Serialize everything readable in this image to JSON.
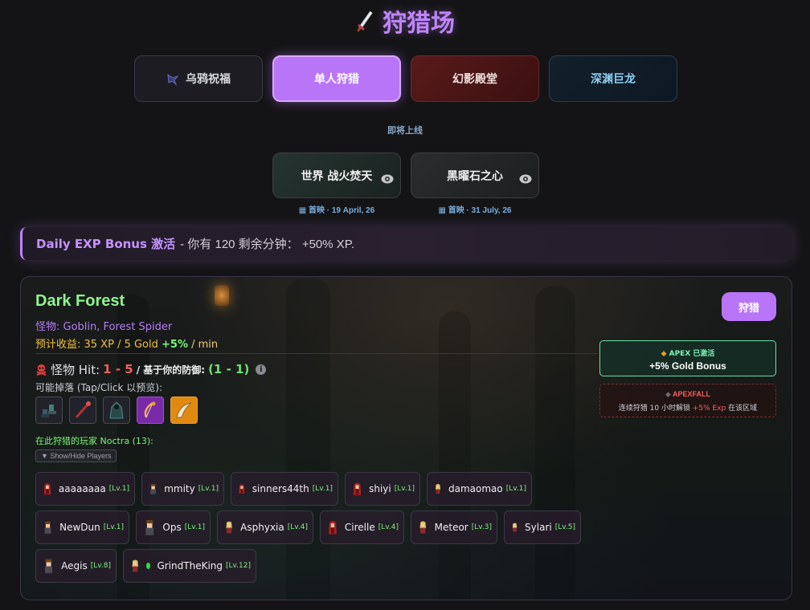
{
  "header": {
    "title": "狩猎场",
    "icon": "sword-icon"
  },
  "modes": {
    "crow": {
      "label": "乌鸦祝福",
      "icon": "crow-icon"
    },
    "solo": {
      "label": "单人狩猎"
    },
    "phantom": {
      "label": "幻影殿堂"
    },
    "abyss": {
      "label": "深渊巨龙"
    }
  },
  "coming_soon": "即将上线",
  "upcoming": {
    "world": {
      "label": "世界 战火焚天",
      "premiere": "首映 · 19 April, 26"
    },
    "obsidian": {
      "label": "黑曜石之心",
      "premiere": "首映 · 31 July, 26"
    }
  },
  "exp_bonus": {
    "label": "Daily EXP Bonus 激活",
    "text": "- 你有 120 剩余分钟： +50% XP."
  },
  "zone": {
    "name": "Dark Forest",
    "monsters": "怪物: Goblin, Forest Spider",
    "income_prefix": "预计收益: 35 XP / 5 Gold",
    "income_boost": "+5%",
    "income_unit": "/ min",
    "hit_label": "怪物 Hit:",
    "hit_value": "1 - 5",
    "based_label": "/ 基于你的防御:",
    "def_value": "(1 - 1)",
    "drops_label": "可能掉落 (Tap/Click 以预览):",
    "drops": [
      {
        "name": "boots",
        "rarity": "common"
      },
      {
        "name": "staff",
        "rarity": "common"
      },
      {
        "name": "cloak",
        "rarity": "common"
      },
      {
        "name": "bow",
        "rarity": "epic"
      },
      {
        "name": "fang",
        "rarity": "legendary"
      }
    ],
    "players_label": "在此狩猎的玩家 Noctra (13):",
    "toggle_label": "▼ Show/Hide Players",
    "hunt_button": "狩猎",
    "apex": {
      "title": "APEX 已激活",
      "bonus": "+5% Gold Bonus"
    },
    "apexfall": {
      "title": "APEXFALL",
      "prefix": "连续狩猎 10 小时解锁",
      "highlight": "+5% Exp",
      "suffix": "在该区域"
    }
  },
  "players": [
    {
      "name": "aaaaaaaa",
      "level": "[Lv.1]",
      "avatar": "red-hood"
    },
    {
      "name": "mmity",
      "level": "[Lv.1]",
      "avatar": "brown-hair"
    },
    {
      "name": "sinners44th",
      "level": "[Lv.1]",
      "avatar": "red-hood"
    },
    {
      "name": "shiyi",
      "level": "[Lv.1]",
      "avatar": "red-hood"
    },
    {
      "name": "damaomao",
      "level": "[Lv.1]",
      "avatar": "blonde"
    },
    {
      "name": "NewDun",
      "level": "[Lv.1]",
      "avatar": "brown-hair"
    },
    {
      "name": "Ops",
      "level": "[Lv.1]",
      "avatar": "brown-hair"
    },
    {
      "name": "Asphyxia",
      "level": "[Lv.4]",
      "avatar": "blonde"
    },
    {
      "name": "Cirelle",
      "level": "[Lv.4]",
      "avatar": "red-hood"
    },
    {
      "name": "Meteor",
      "level": "[Lv.3]",
      "avatar": "blonde"
    },
    {
      "name": "Sylari",
      "level": "[Lv.5]",
      "avatar": "blonde"
    },
    {
      "name": "Aegis",
      "level": "[Lv.8]",
      "avatar": "brown-hair"
    },
    {
      "name": "GrindTheKing",
      "level": "[Lv.12]",
      "avatar": "blonde",
      "online": true
    }
  ],
  "colors": {
    "accent": "#c084fc",
    "button": "#b975f8",
    "zone_name": "#8ef58e",
    "gold": "#f0c040",
    "danger": "#f06060"
  }
}
